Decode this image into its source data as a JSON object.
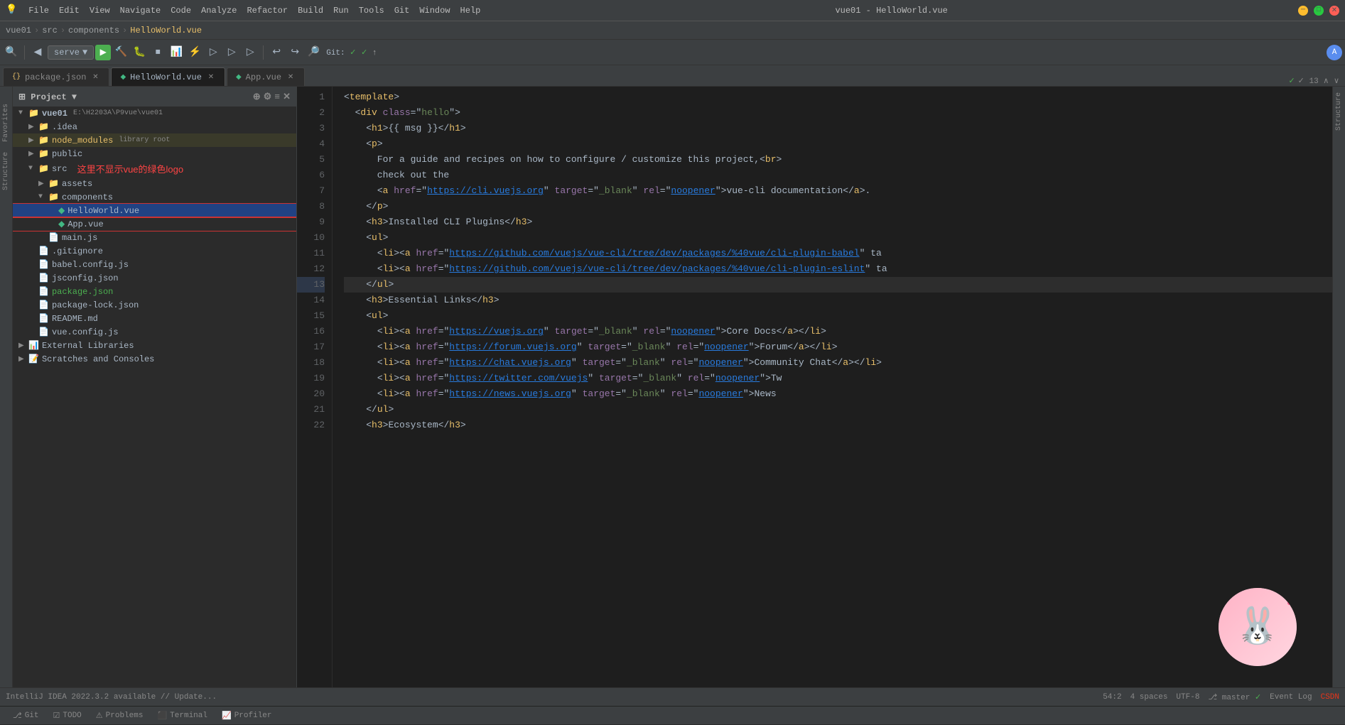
{
  "titleBar": {
    "title": "vue01 - HelloWorld.vue",
    "menuItems": [
      "File",
      "Edit",
      "View",
      "Navigate",
      "Code",
      "Analyze",
      "Refactor",
      "Build",
      "Run",
      "Tools",
      "Git",
      "Window",
      "Help"
    ]
  },
  "breadcrumb": {
    "items": [
      "vue01",
      "src",
      "components",
      "HelloWorld.vue"
    ]
  },
  "toolbar": {
    "serve": "serve",
    "git": "Git:",
    "checkmarks": "✓ ✓ ↑"
  },
  "tabs": [
    {
      "name": "package.json",
      "icon": "{}",
      "active": false
    },
    {
      "name": "HelloWorld.vue",
      "icon": "◆",
      "active": true
    },
    {
      "name": "App.vue",
      "icon": "◆",
      "active": false
    }
  ],
  "sidebar": {
    "title": "Project",
    "tree": [
      {
        "level": 0,
        "type": "folder",
        "name": "vue01",
        "badge": "E:\\H2203A\\P9vue\\vue01",
        "open": true,
        "selected": false
      },
      {
        "level": 1,
        "type": "folder",
        "name": ".idea",
        "open": false,
        "selected": false
      },
      {
        "level": 1,
        "type": "folder-special",
        "name": "node_modules",
        "badge": "library root",
        "open": false,
        "selected": false
      },
      {
        "level": 1,
        "type": "folder",
        "name": "public",
        "open": false,
        "selected": false
      },
      {
        "level": 1,
        "type": "folder",
        "name": "src",
        "open": true,
        "selected": false
      },
      {
        "level": 2,
        "type": "folder",
        "name": "assets",
        "open": false,
        "selected": false
      },
      {
        "level": 2,
        "type": "folder",
        "name": "components",
        "open": true,
        "selected": false
      },
      {
        "level": 3,
        "type": "vue",
        "name": "HelloWorld.vue",
        "open": false,
        "selected": true
      },
      {
        "level": 3,
        "type": "vue",
        "name": "App.vue",
        "open": false,
        "selected": false
      },
      {
        "level": 2,
        "type": "js",
        "name": "main.js",
        "open": false,
        "selected": false
      },
      {
        "level": 1,
        "type": "git",
        "name": ".gitignore",
        "open": false,
        "selected": false
      },
      {
        "level": 1,
        "type": "js",
        "name": "babel.config.js",
        "open": false,
        "selected": false
      },
      {
        "level": 1,
        "type": "json",
        "name": "jsconfig.json",
        "open": false,
        "selected": false
      },
      {
        "level": 1,
        "type": "json-special",
        "name": "package.json",
        "open": false,
        "selected": false
      },
      {
        "level": 1,
        "type": "json",
        "name": "package-lock.json",
        "open": false,
        "selected": false
      },
      {
        "level": 1,
        "type": "md",
        "name": "README.md",
        "open": false,
        "selected": false
      },
      {
        "level": 1,
        "type": "js",
        "name": "vue.config.js",
        "open": false,
        "selected": false
      },
      {
        "level": 0,
        "type": "folder",
        "name": "External Libraries",
        "open": false,
        "selected": false
      },
      {
        "level": 0,
        "type": "folder",
        "name": "Scratches and Consoles",
        "open": false,
        "selected": false
      }
    ]
  },
  "annotation": {
    "text": "这里不显示vue的绿色logo",
    "style": "color: #ff4444"
  },
  "code": {
    "lines": [
      {
        "num": 1,
        "content": "<template>"
      },
      {
        "num": 2,
        "content": "  <div class=\"hello\">"
      },
      {
        "num": 3,
        "content": "    <h1>{{ msg }}</h1>"
      },
      {
        "num": 4,
        "content": "    <p>"
      },
      {
        "num": 5,
        "content": "      For a guide and recipes on how to configure / customize this project,<br>"
      },
      {
        "num": 6,
        "content": "      check out the"
      },
      {
        "num": 7,
        "content": "      <a href=\"https://cli.vuejs.org\" target=\"_blank\" rel=\"noopener\">vue-cli documentation</a>."
      },
      {
        "num": 8,
        "content": "    </p>"
      },
      {
        "num": 9,
        "content": "    <h3>Installed CLI Plugins</h3>"
      },
      {
        "num": 10,
        "content": "    <ul>"
      },
      {
        "num": 11,
        "content": "      <li><a href=\"https://github.com/vuejs/vue-cli/tree/dev/packages/%40vue/cli-plugin-babel\" ta"
      },
      {
        "num": 12,
        "content": "      <li><a href=\"https://github.com/vuejs/vue-cli/tree/dev/packages/%40vue/cli-plugin-eslint\" ta"
      },
      {
        "num": 13,
        "content": "    </ul>"
      },
      {
        "num": 14,
        "content": "    <h3>Essential Links</h3>"
      },
      {
        "num": 15,
        "content": "    <ul>"
      },
      {
        "num": 16,
        "content": "      <li><a href=\"https://vuejs.org\" target=\"_blank\" rel=\"noopener\">Core Docs</a></li>"
      },
      {
        "num": 17,
        "content": "      <li><a href=\"https://forum.vuejs.org\" target=\"_blank\" rel=\"noopener\">Forum</a></li>"
      },
      {
        "num": 18,
        "content": "      <li><a href=\"https://chat.vuejs.org\" target=\"_blank\" rel=\"noopener\">Community Chat</a></li>"
      },
      {
        "num": 19,
        "content": "      <li><a href=\"https://twitter.com/vuejs\" target=\"_blank\" rel=\"noopener\">Tw"
      },
      {
        "num": 20,
        "content": "      <li><a href=\"https://news.vuejs.org\" target=\"_blank\" rel=\"noopener\">News"
      },
      {
        "num": 21,
        "content": "    </ul>"
      },
      {
        "num": 22,
        "content": "    <h3>Ecosystem</h3>"
      }
    ]
  },
  "lineCount": "✓ 13  ∧  ∨",
  "statusBar": {
    "position": "54:2",
    "spaces": "4 spaces",
    "encoding": "UTF-8",
    "crlf": "",
    "branch": "master",
    "git_status": "✓",
    "notification": "IntelliJ IDEA 2022.3.2 available // Update...",
    "event_log": "Event Log"
  },
  "bottomBar": {
    "tabs": [
      {
        "name": "Git",
        "icon": "git"
      },
      {
        "name": "TODO",
        "icon": "todo"
      },
      {
        "name": "Problems",
        "icon": "problems"
      },
      {
        "name": "Terminal",
        "icon": "terminal"
      },
      {
        "name": "Profiler",
        "icon": "profiler"
      }
    ]
  },
  "rightSide": {
    "label": "Structure"
  },
  "leftSide": {
    "labels": [
      "Favorites",
      "Structure"
    ]
  }
}
